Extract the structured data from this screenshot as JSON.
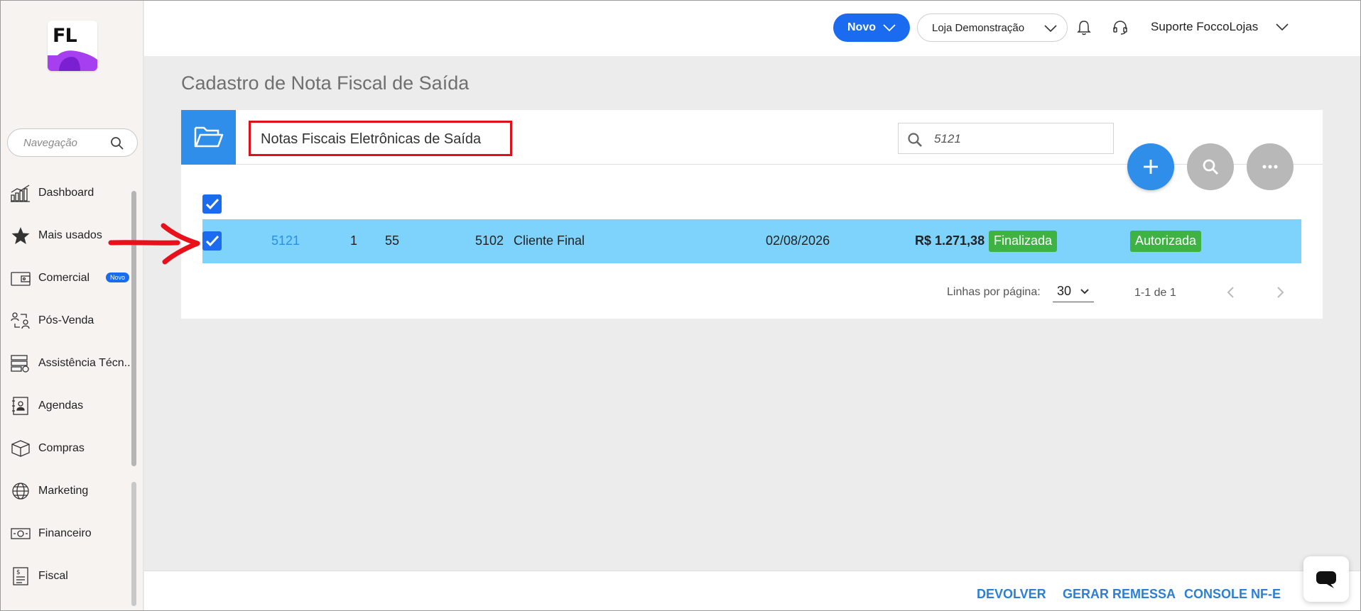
{
  "app": {
    "logo_text": "FL",
    "brand_color": "#1a6bf0"
  },
  "sidebar": {
    "search_placeholder": "Navegação",
    "items": [
      {
        "label": "Dashboard",
        "icon": "chart-bars-icon"
      },
      {
        "label": "Mais usados",
        "icon": "star-icon"
      },
      {
        "label": "Comercial",
        "icon": "wallet-icon",
        "badge": "Novo"
      },
      {
        "label": "Pós-Venda",
        "icon": "exchange-people-icon"
      },
      {
        "label": "Assistência Técn...",
        "icon": "server-gear-icon"
      },
      {
        "label": "Agendas",
        "icon": "contact-book-icon"
      },
      {
        "label": "Compras",
        "icon": "box-icon"
      },
      {
        "label": "Marketing",
        "icon": "globe-icon"
      },
      {
        "label": "Financeiro",
        "icon": "cash-icon"
      },
      {
        "label": "Fiscal",
        "icon": "receipt-icon"
      }
    ]
  },
  "header": {
    "new_button": "Novo",
    "store": "Loja Demonstração",
    "user": "Suporte FoccoLojas"
  },
  "main": {
    "page_title": "Cadastro de Nota Fiscal de Saída",
    "card_title": "Notas Fiscais Eletrônicas de Saída",
    "search_value": "5121",
    "row": {
      "numero": "5121",
      "serie": "1",
      "modelo": "55",
      "cfop": "5102",
      "cliente": "Cliente Final",
      "data": "02/08/2026",
      "valor": "R$ 1.271,38",
      "status": "Finalizada",
      "sefaz": "Autorizada"
    },
    "pagination": {
      "rows_label": "Linhas por página:",
      "rows_value": "30",
      "range": "1-1 de 1"
    }
  },
  "footer": {
    "devolver": "DEVOLVER",
    "gerar_remessa": "GERAR REMESSA",
    "console_nfe": "CONSOLE NF-E"
  }
}
